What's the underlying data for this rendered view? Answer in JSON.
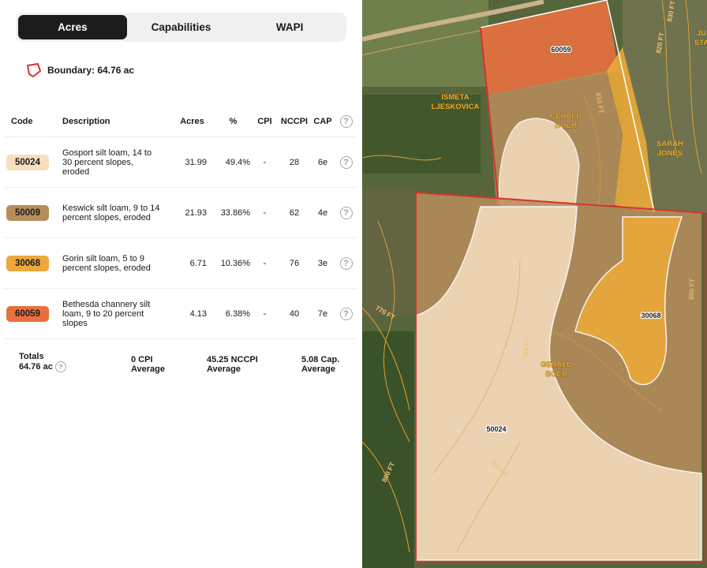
{
  "tabs": [
    {
      "label": "Acres",
      "active": true
    },
    {
      "label": "Capabilities",
      "active": false
    },
    {
      "label": "WAPI",
      "active": false
    }
  ],
  "boundary": {
    "text": "Boundary: 64.76 ac"
  },
  "table": {
    "headers": {
      "code": "Code",
      "description": "Description",
      "acres": "Acres",
      "pct": "%",
      "cpi": "CPI",
      "nccpi": "NCCPI",
      "cap": "CAP"
    },
    "rows": [
      {
        "code": "50024",
        "color": "#f6dfbf",
        "description": "Gosport silt loam, 14 to 30 percent slopes, eroded",
        "acres": "31.99",
        "pct": "49.4%",
        "cpi": "-",
        "nccpi": "28",
        "cap": "6e"
      },
      {
        "code": "50009",
        "color": "#b88d5c",
        "description": "Keswick silt loam, 9 to 14 percent slopes, eroded",
        "acres": "21.93",
        "pct": "33.86%",
        "cpi": "-",
        "nccpi": "62",
        "cap": "4e"
      },
      {
        "code": "30068",
        "color": "#eaa93a",
        "description": "Gorin silt loam, 5 to 9 percent slopes, eroded",
        "acres": "6.71",
        "pct": "10.36%",
        "cpi": "-",
        "nccpi": "76",
        "cap": "3e"
      },
      {
        "code": "60059",
        "color": "#e8703f",
        "description": "Bethesda channery silt loam, 9 to 20 percent slopes",
        "acres": "4.13",
        "pct": "6.38%",
        "cpi": "-",
        "nccpi": "40",
        "cap": "7e"
      }
    ]
  },
  "totals": {
    "label": "Totals",
    "acres": "64.76 ac",
    "cpi_value": "0 CPI",
    "cpi_sub": "Average",
    "nccpi_value": "45.25 NCCPI",
    "nccpi_sub": "Average",
    "cap_value": "5.08 Cap.",
    "cap_sub": "Average"
  },
  "map": {
    "soil_labels": [
      "60059",
      "30068",
      "50024"
    ],
    "owner_labels": [
      {
        "line1": "ISMETA",
        "line2": "LJESKOVICA"
      },
      {
        "line1": "GERALD",
        "line2": "BOER"
      },
      {
        "line1": "SARAH",
        "line2": "JONES"
      },
      {
        "line1": "GERALD",
        "line2": "BOER"
      },
      {
        "line1": "JU",
        "line2": "STA"
      }
    ],
    "contour_labels": [
      "810 FT",
      "820 FT",
      "830 FT",
      "780 FT",
      "800 FT",
      "770 FT",
      "750 FT",
      "800 FT"
    ]
  },
  "colors": {
    "boundary": "#d8322f",
    "tab_active": "#1c1c1c",
    "contour": "#e0a030"
  },
  "icons": {
    "boundary": "polygon-boundary-icon",
    "help": "question-circle-icon"
  }
}
